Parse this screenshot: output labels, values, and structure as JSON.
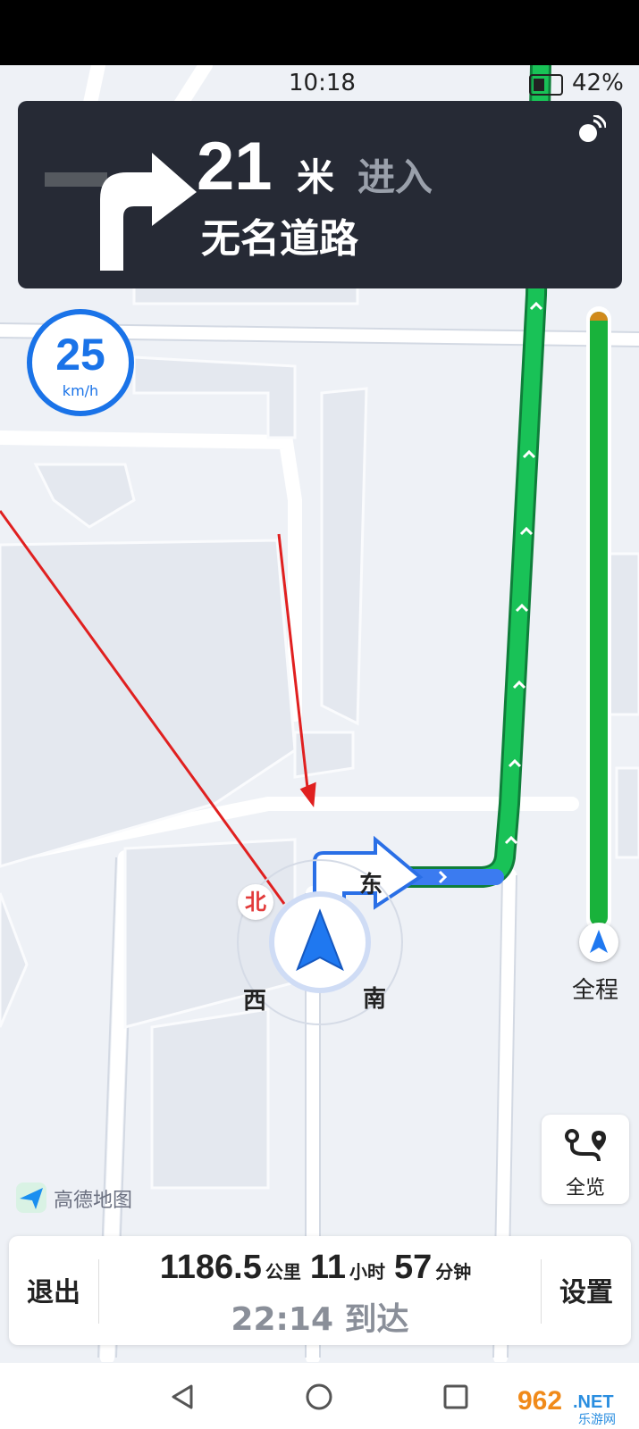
{
  "status": {
    "time": "10:18",
    "battery": "42%"
  },
  "guidance": {
    "distance": "21",
    "unit": "米",
    "action": "进入",
    "road": "无名道路",
    "turn_icon": "turn-right-arrow-icon",
    "sat_icon": "satellite-icon"
  },
  "speed": {
    "value": "25",
    "unit": "km/h"
  },
  "compass": {
    "north": "北",
    "east": "东",
    "west": "西",
    "south": "南"
  },
  "progress": {
    "label": "全程",
    "colors": {
      "route": "#19b23b",
      "accent": "#1a73e8"
    }
  },
  "overview_button": {
    "label": "全览"
  },
  "brand": {
    "name": "高德地图"
  },
  "trip": {
    "exit": "退出",
    "settings": "设置",
    "distance": "1186.5",
    "distance_unit": "公里",
    "hours": "11",
    "hours_unit": "小时",
    "minutes": "57",
    "minutes_unit": "分钟",
    "arrival": "22:14 到达"
  },
  "sysnav": {
    "back": "back-triangle-icon",
    "home": "home-circle-icon",
    "recent": "recent-square-icon"
  },
  "watermark": {
    "text": "962",
    "suffix": ".NET",
    "sub": "乐游网"
  }
}
